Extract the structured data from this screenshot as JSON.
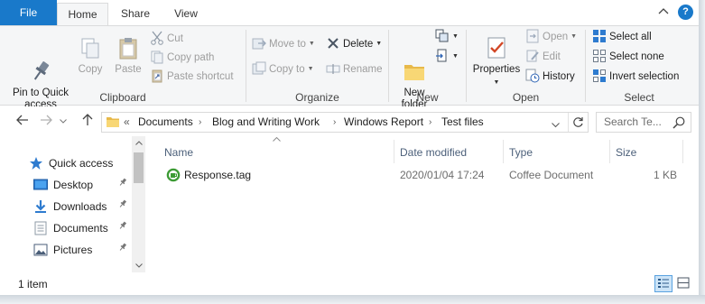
{
  "tabs": {
    "file": "File",
    "home": "Home",
    "share": "Share",
    "view": "View"
  },
  "titlebar": {
    "collapse_icon": "chevron-up-icon",
    "help": "?"
  },
  "ribbon": {
    "clipboard": {
      "label": "Clipboard",
      "pin": "Pin to Quick\naccess",
      "copy": "Copy",
      "paste": "Paste",
      "cut": "Cut",
      "copy_path": "Copy path",
      "paste_shortcut": "Paste shortcut"
    },
    "organize": {
      "label": "Organize",
      "move_to": "Move to",
      "copy_to": "Copy to",
      "delete": "Delete",
      "rename": "Rename"
    },
    "new": {
      "label": "New",
      "new_folder": "New\nfolder"
    },
    "open": {
      "label": "Open",
      "properties": "Properties",
      "open": "Open",
      "edit": "Edit",
      "history": "History"
    },
    "select": {
      "label": "Select",
      "select_all": "Select all",
      "select_none": "Select none",
      "invert_selection": "Invert selection"
    }
  },
  "address": {
    "overflow": "«",
    "crumbs": [
      "Documents",
      "Blog and Writing Work",
      "Windows Report",
      "Test files"
    ],
    "search_placeholder": "Search Te..."
  },
  "nav": {
    "items": [
      {
        "label": "Quick access",
        "icon": "star-icon"
      },
      {
        "label": "Desktop",
        "icon": "desktop-icon",
        "pinned": true
      },
      {
        "label": "Downloads",
        "icon": "download-icon",
        "pinned": true
      },
      {
        "label": "Documents",
        "icon": "documents-icon",
        "pinned": true
      },
      {
        "label": "Pictures",
        "icon": "pictures-icon",
        "pinned": true
      }
    ]
  },
  "columns": {
    "name": "Name",
    "date": "Date modified",
    "type": "Type",
    "size": "Size"
  },
  "files": [
    {
      "name": "Response.tag",
      "date": "2020/01/04 17:24",
      "type": "Coffee Document",
      "size": "1 KB",
      "icon": "coffee-file-icon"
    }
  ],
  "status": {
    "count": "1 item"
  },
  "colors": {
    "accent": "#1979ca",
    "ribbon_bg": "#f5f6f7",
    "header_text": "#4c607a",
    "folder": "#f8d775"
  }
}
